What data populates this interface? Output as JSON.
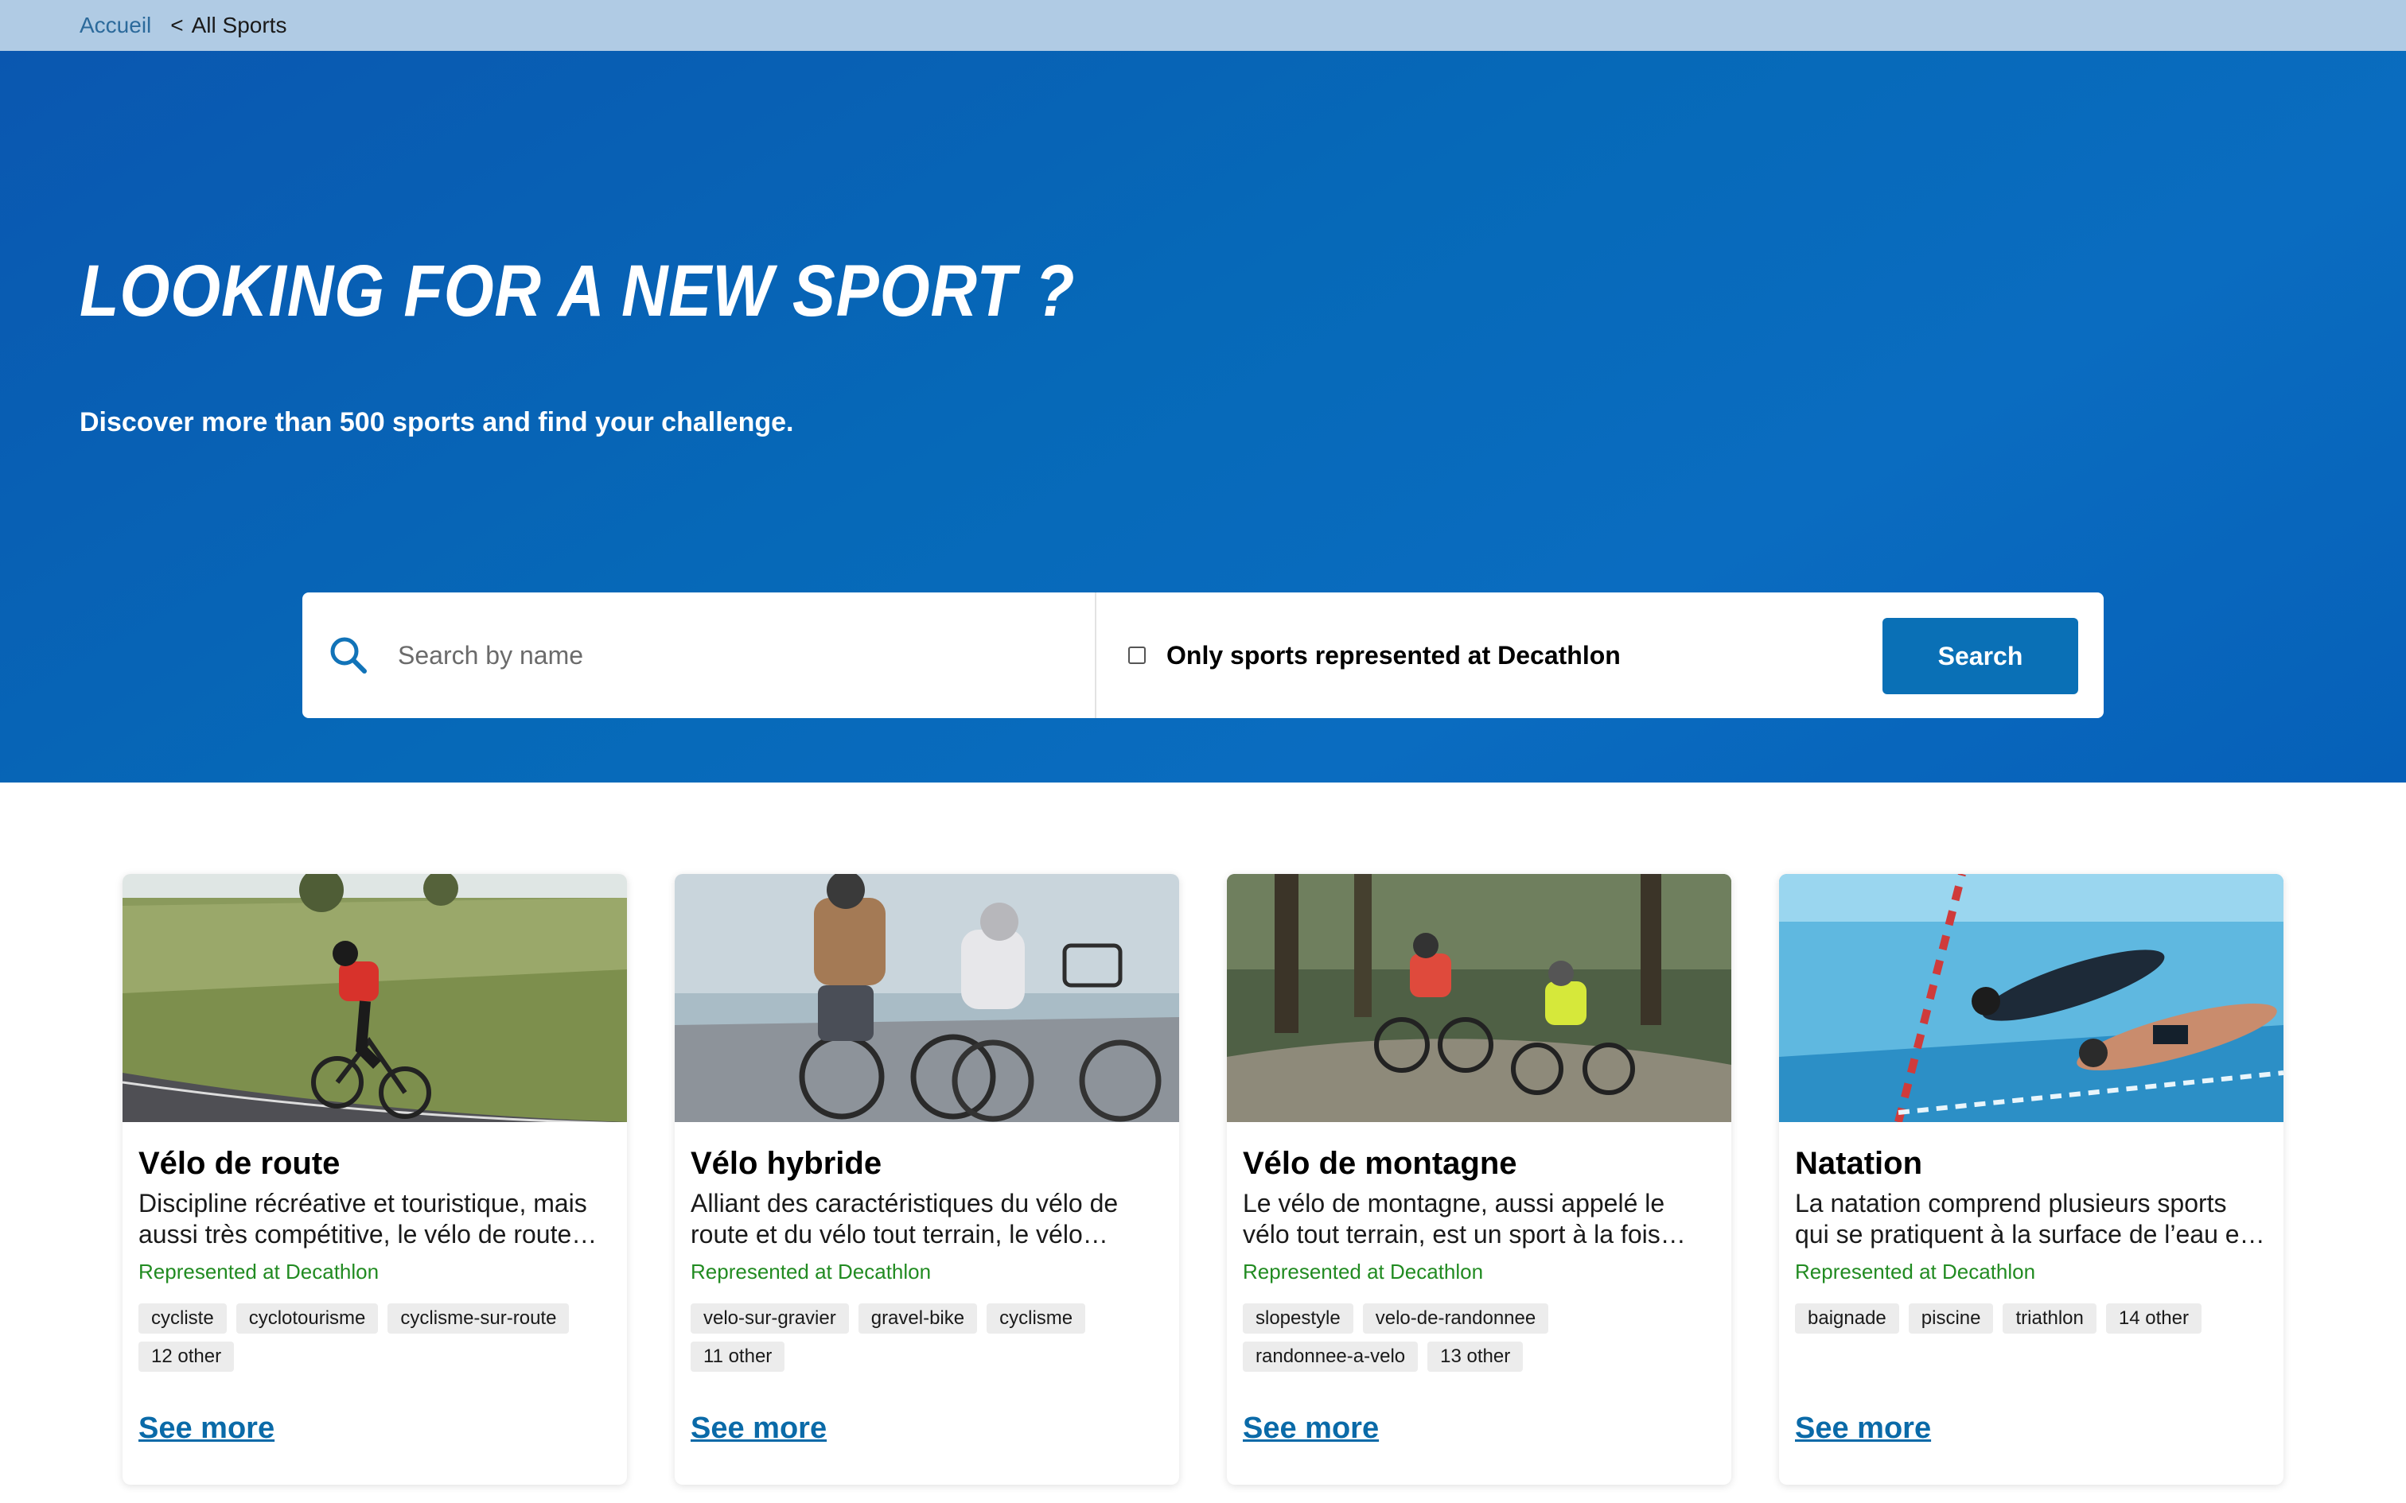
{
  "breadcrumb": {
    "home": "Accueil",
    "separator": "<",
    "current": "All Sports"
  },
  "hero": {
    "title": "LOOKING FOR A NEW SPORT ?",
    "subtitle": "Discover more than 500 sports and find your challenge."
  },
  "search": {
    "placeholder": "Search by name",
    "checkbox_label": "Only sports represented at Decathlon",
    "button_label": "Search"
  },
  "cards": [
    {
      "title": "Vélo de route",
      "description": "Discipline récréative et touristique, mais aussi très compétitive, le vélo de route est une discipline de cyclisme pratiquée sur routes goudronnées.",
      "represented": "Represented at Decathlon",
      "tags": [
        "cycliste",
        "cyclotourisme",
        "cyclisme-sur-route",
        "12 other"
      ],
      "see_more": "See more"
    },
    {
      "title": "Vélo hybride",
      "description": "Alliant des caractéristiques du vélo de route et du vélo tout terrain, le vélo hybride est idéal pour la ville et les chemins.",
      "represented": "Represented at Decathlon",
      "tags": [
        "velo-sur-gravier",
        "gravel-bike",
        "cyclisme",
        "11 other"
      ],
      "see_more": "See more"
    },
    {
      "title": "Vélo de montagne",
      "description": "Le vélo de montagne, aussi appelé le vélo tout terrain, est un sport à la fois récréatif et compétitif pratiqué en pleine nature.",
      "represented": "Represented at Decathlon",
      "tags": [
        "slopestyle",
        "velo-de-randonnee",
        "randonnee-a-velo",
        "13 other"
      ],
      "see_more": "See more"
    },
    {
      "title": "Natation",
      "description": "La natation comprend plusieurs sports qui se pratiquent à la surface de l’eau et sous l’eau.",
      "represented": "Represented at Decathlon",
      "tags": [
        "baignade",
        "piscine",
        "triathlon",
        "14 other"
      ],
      "see_more": "See more"
    }
  ]
}
